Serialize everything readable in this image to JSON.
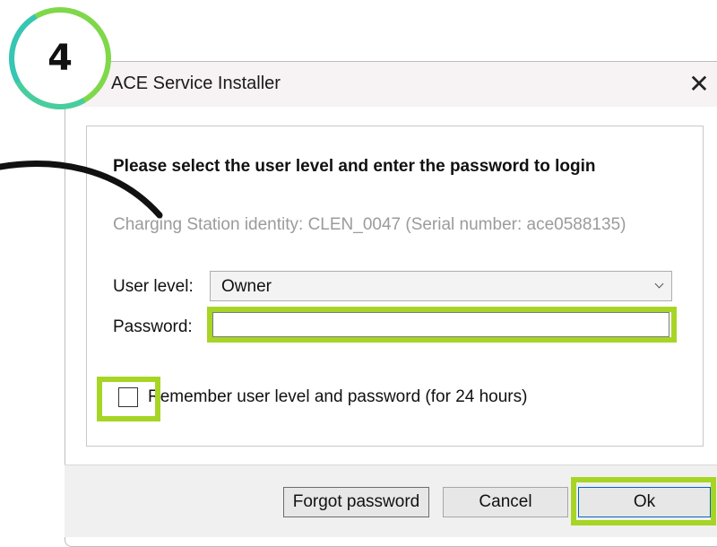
{
  "step": {
    "number": "4"
  },
  "window": {
    "title": "ACE Service Installer",
    "close_glyph": "✕"
  },
  "form": {
    "heading": "Please select the user level and enter the password to login",
    "identity": "Charging Station identity: CLEN_0047 (Serial number: ace0588135)",
    "user_level_label": "User level:",
    "user_level_value": "Owner",
    "password_label": "Password:",
    "password_value": "",
    "remember_label": "Remember user level and password (for 24 hours)",
    "remember_checked": false
  },
  "buttons": {
    "forgot": "Forgot password",
    "cancel": "Cancel",
    "ok": "Ok"
  },
  "colors": {
    "highlight": "#a7d525",
    "accent_ring": "#36c6b5",
    "ok_border": "#0067c0"
  },
  "icons": {
    "close": "close-icon",
    "dropdown": "chevron-down-icon",
    "checkbox": "checkbox-icon"
  }
}
